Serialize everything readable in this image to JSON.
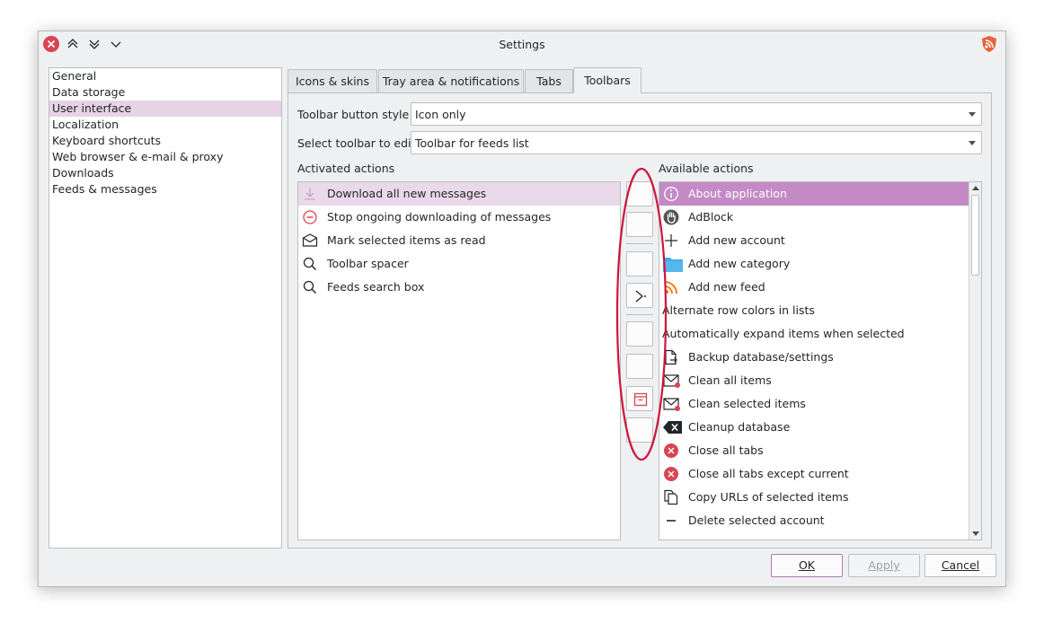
{
  "window": {
    "title": "Settings"
  },
  "categories": [
    {
      "label": "General",
      "selected": false
    },
    {
      "label": "Data storage",
      "selected": false
    },
    {
      "label": "User interface",
      "selected": true
    },
    {
      "label": "Localization",
      "selected": false
    },
    {
      "label": "Keyboard shortcuts",
      "selected": false
    },
    {
      "label": "Web browser & e-mail & proxy",
      "selected": false
    },
    {
      "label": "Downloads",
      "selected": false
    },
    {
      "label": "Feeds & messages",
      "selected": false
    }
  ],
  "tabs": [
    {
      "label": "Icons & skins"
    },
    {
      "label": "Tray area & notifications"
    },
    {
      "label": "Tabs"
    },
    {
      "label": "Toolbars",
      "active": true
    }
  ],
  "toolbar_style": {
    "label": "Toolbar button style",
    "value": "Icon only"
  },
  "toolbar_select": {
    "label": "Select toolbar to edit",
    "value": "Toolbar for feeds list"
  },
  "activated": {
    "label": "Activated actions",
    "items": [
      {
        "label": "Download all new messages",
        "icon": "download-icon"
      },
      {
        "label": "Stop ongoing downloading of messages",
        "icon": "stop-icon"
      },
      {
        "label": "Mark selected items as read",
        "icon": "envelope-icon"
      },
      {
        "label": "Toolbar spacer",
        "icon": "search-icon"
      },
      {
        "label": "Feeds search box",
        "icon": "search-icon"
      }
    ]
  },
  "available": {
    "label": "Available actions",
    "items": [
      {
        "label": "About application",
        "icon": "info-icon"
      },
      {
        "label": "AdBlock",
        "icon": "hand-icon"
      },
      {
        "label": "Add new account",
        "icon": "plus-icon"
      },
      {
        "label": "Add new category",
        "icon": "folder-icon"
      },
      {
        "label": "Add new feed",
        "icon": "rss-icon"
      },
      {
        "label": "Alternate row colors in lists",
        "icon": ""
      },
      {
        "label": "Automatically expand items when selected",
        "icon": ""
      },
      {
        "label": "Backup database/settings",
        "icon": "document-export-icon"
      },
      {
        "label": "Clean all items",
        "icon": "mail-clean-icon"
      },
      {
        "label": "Clean selected items",
        "icon": "mail-clean-icon"
      },
      {
        "label": "Cleanup database",
        "icon": "backspace-icon"
      },
      {
        "label": "Close all tabs",
        "icon": "close-circle-icon"
      },
      {
        "label": "Close all tabs except current",
        "icon": "close-circle-icon"
      },
      {
        "label": "Copy URLs of selected items",
        "icon": "copy-icon"
      },
      {
        "label": "Delete selected account",
        "icon": "minus-icon"
      }
    ]
  },
  "buttons": {
    "ok": "OK",
    "apply": "Apply",
    "cancel": "Cancel"
  },
  "colors": {
    "accent": "#c38ac6",
    "annotation": "#d0143c",
    "close": "#da4453"
  }
}
